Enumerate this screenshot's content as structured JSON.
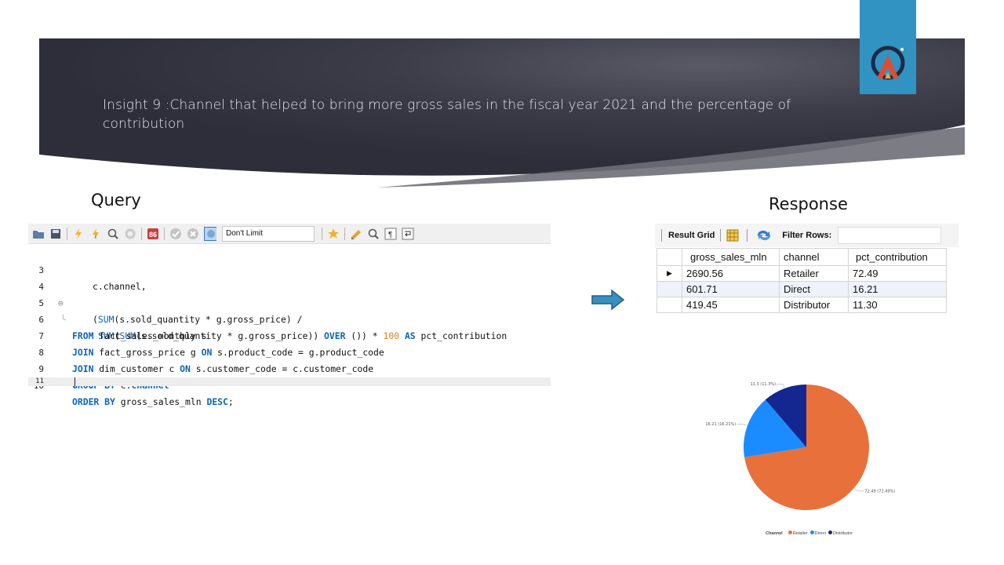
{
  "slide": {
    "title": "Insight 9 :Channel  that helped to bring more gross sales in the fiscal year 2021 and the percentage of contribution",
    "query_heading": "Query",
    "response_heading": "Response"
  },
  "editor": {
    "limit_value": "Don't Limit",
    "toolbar_icons": [
      "open-folder-icon",
      "save-icon",
      "execute-icon",
      "execute-current-icon",
      "explain-icon",
      "stop-icon",
      "toggle-error-icon",
      "commit-icon",
      "rollback-icon",
      "autocommit-icon",
      "bookmark-star-icon",
      "beautify-icon",
      "find-icon",
      "invisible-chars-icon",
      "wrap-icon"
    ],
    "lines": [
      {
        "n": "3"
      },
      {
        "n": "4"
      },
      {
        "n": "5"
      },
      {
        "n": "6"
      },
      {
        "n": "7"
      },
      {
        "n": "8"
      },
      {
        "n": "9"
      },
      {
        "n": "10"
      },
      {
        "n": "11"
      }
    ],
    "code": {
      "l3": "c.channel,",
      "l4_a": "(",
      "l4_fn": "SUM",
      "l4_b": "(s.sold_quantity * g.gross_price) /",
      "l5_fn1": "SUM",
      "l5_a": "(",
      "l5_fn2": "SUM",
      "l5_b": "(s.sold_quantity * g.gross_price)) ",
      "l5_kw1": "OVER",
      "l5_c": " ()) * ",
      "l5_num": "100",
      "l5_d": " ",
      "l5_kw2": "AS",
      "l5_e": " pct_contribution",
      "l6_kw": "FROM",
      "l6_t": " fact_sales_monthly s",
      "l7_kw": "JOIN",
      "l7_t": " fact_gross_price g ",
      "l7_kw2": "ON",
      "l7_t2": " s.product_code = g.product_code",
      "l8_kw": "JOIN",
      "l8_t": " dim_customer c ",
      "l8_kw2": "ON",
      "l8_t2": " s.customer_code = c.customer_code",
      "l9_kw": "GROUP BY",
      "l9_t": " c.",
      "l9_col": "channel",
      "l10_kw": "ORDER BY",
      "l10_t": " gross_sales_mln ",
      "l10_kw2": "DESC",
      "l10_end": ";"
    }
  },
  "result_grid": {
    "toolbar_label": "Result Grid",
    "filter_label": "Filter Rows:",
    "columns": [
      "gross_sales_mln",
      "channel",
      "pct_contribution"
    ],
    "rows": [
      [
        "2690.56",
        "Retailer",
        "72.49"
      ],
      [
        "601.71",
        "Direct",
        "16.21"
      ],
      [
        "419.45",
        "Distributor",
        "11.30"
      ]
    ]
  },
  "chart_data": {
    "type": "pie",
    "categories": [
      "Retailer",
      "Direct",
      "Distributor"
    ],
    "values": [
      72.49,
      16.21,
      11.3
    ],
    "data_labels": [
      "72.49 (72.49%)",
      "16.21 (16.21%)",
      "11.3 (11.3%)"
    ],
    "colors": [
      "#e8703a",
      "#1a8cff",
      "#14268f"
    ],
    "legend_title": "Channel",
    "legend_position": "bottom"
  },
  "colors": {
    "banner_dark": "#343440",
    "logo_tab": "#3193c2",
    "keyword": "#0a63b8",
    "number": "#e0801b",
    "arrow": "#3a8fbf"
  }
}
